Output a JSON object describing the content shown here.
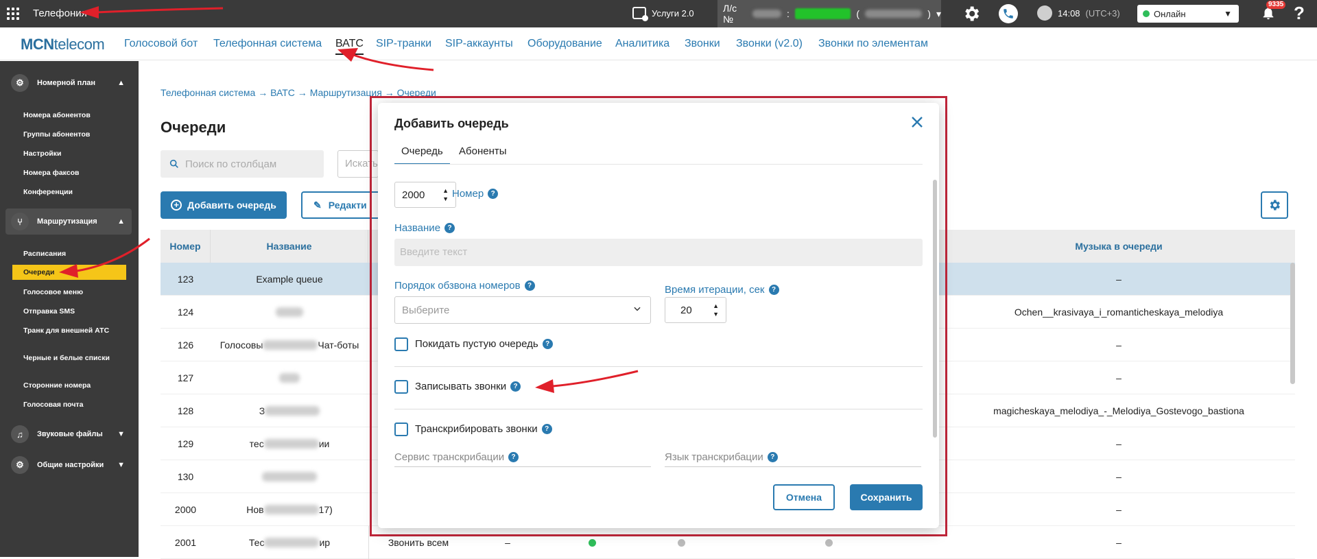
{
  "topbar": {
    "app_title": "Телефония",
    "services_label": "Услуги 2.0",
    "account_prefix": "Л/с №",
    "account_sep": ":",
    "account_paren_open": "(",
    "account_paren_close": ")",
    "time": "14:08",
    "timezone": "(UTC+3)",
    "status": "Онлайн",
    "notifications_count": "9335",
    "help": "?"
  },
  "nav": {
    "logo_bold": "MCN",
    "logo_rest": "telecom",
    "items": [
      {
        "label": "Голосовой бот"
      },
      {
        "label": "Телефонная система"
      },
      {
        "label": "ВАТС"
      },
      {
        "label": "SIP-транки"
      },
      {
        "label": "SIP-аккаунты"
      },
      {
        "label": "Оборудование"
      },
      {
        "label": "Аналитика"
      },
      {
        "label": "Звонки"
      },
      {
        "label": "Звонки (v2.0)"
      },
      {
        "label": "Звонки по элементам"
      }
    ]
  },
  "sidebar": {
    "groups": [
      {
        "label": "Номерной план"
      },
      {
        "label": "Маршрутизация"
      },
      {
        "label": "Звуковые файлы"
      },
      {
        "label": "Общие настройки"
      }
    ],
    "plan_items": [
      {
        "label": "Номера абонентов"
      },
      {
        "label": "Группы абонентов"
      },
      {
        "label": "Настройки"
      },
      {
        "label": "Номера факсов"
      },
      {
        "label": "Конференции"
      }
    ],
    "routing_items": [
      {
        "label": "Расписания"
      },
      {
        "label": "Очереди"
      },
      {
        "label": "Голосовое меню"
      },
      {
        "label": "Отправка SMS"
      },
      {
        "label": "Транк для внешней АТС"
      },
      {
        "label": "Черные и белые списки"
      },
      {
        "label": "Сторонние номера"
      },
      {
        "label": "Голосовая почта"
      }
    ]
  },
  "page": {
    "breadcrumbs": [
      "Телефонная система",
      "ВАТС",
      "Маршрутизация",
      "Очереди"
    ],
    "crumb_sep": "→",
    "title": "Очереди",
    "search_placeholder": "Поиск по столбцам",
    "search2_placeholder": "Искать",
    "add_button": "Добавить очередь",
    "edit_button": "Редакти"
  },
  "table": {
    "headers": {
      "number": "Номер",
      "name": "Название",
      "music": "Музыка в очереди"
    },
    "rows": [
      {
        "number": "123",
        "name": "Example queue",
        "music": "–"
      },
      {
        "number": "124",
        "name": "",
        "music": "Ochen__krasivaya_i_romanticheskaya_melodiya"
      },
      {
        "number": "126",
        "name_left": "Голосовы",
        "name_right": "Чат-боты",
        "music": "–"
      },
      {
        "number": "127",
        "name": "",
        "music": "–"
      },
      {
        "number": "128",
        "name_left": "З",
        "name_right": "",
        "music": "magicheskaya_melodiya_-_Melodiya_Gostevogo_bastiona"
      },
      {
        "number": "129",
        "name_left": "тес",
        "name_right": "ии",
        "music": "–"
      },
      {
        "number": "130",
        "name": "",
        "music": "–"
      },
      {
        "number": "2000",
        "name_left": "Нов",
        "name_right": "17)",
        "music": "–"
      },
      {
        "number": "2001",
        "name_left": "Тес",
        "name_right": "ир",
        "strategy": "Звонить всем",
        "dash": "–",
        "music": "–"
      }
    ]
  },
  "modal": {
    "title": "Добавить очередь",
    "tabs": [
      {
        "label": "Очередь"
      },
      {
        "label": "Абоненты"
      }
    ],
    "number_value": "2000",
    "number_label": "Номер",
    "name_label": "Название",
    "name_placeholder": "Введите текст",
    "order_label": "Порядок обзвона номеров",
    "order_placeholder": "Выберите",
    "iteration_label": "Время итерации, сек",
    "iteration_value": "20",
    "leave_empty_label": "Покидать пустую очередь",
    "record_label": "Записывать звонки",
    "transcribe_label": "Транскрибировать звонки",
    "transcribe_service_label": "Сервис транскрибации",
    "transcribe_lang_label": "Язык транскрибации",
    "cancel": "Отмена",
    "save": "Сохранить",
    "help_glyph": "?"
  },
  "colors": {
    "accent": "#2a7ab0",
    "highlight": "#f5c518",
    "frame": "#c0263a",
    "annotation": "#e0202a"
  }
}
